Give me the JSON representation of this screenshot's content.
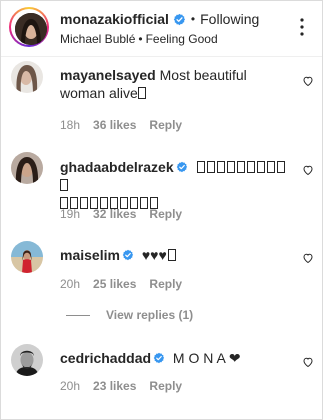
{
  "header": {
    "username": "monazakiofficial",
    "separator": "•",
    "follow_status": "Following",
    "music_artist": "Michael Bublé",
    "music_separator": "•",
    "music_title": "Feeling Good"
  },
  "comments": [
    {
      "username": "mayanelsayed",
      "verified": false,
      "text_line1": "Most beautiful",
      "text_line2": "woman alive",
      "age": "18h",
      "likes": "36 likes",
      "reply": "Reply"
    },
    {
      "username": "ghadaabdelrazek",
      "verified": true,
      "text_line1": "",
      "text_line2": "",
      "age": "19h",
      "likes": "32 likes",
      "reply": "Reply"
    },
    {
      "username": "maiselim",
      "verified": true,
      "text_line1": "♥♥♥",
      "age": "20h",
      "likes": "25 likes",
      "reply": "Reply"
    },
    {
      "username": "cedrichaddad",
      "verified": true,
      "text_line1": "M O N A ❤",
      "age": "20h",
      "likes": "23 likes",
      "reply": "Reply"
    }
  ],
  "view_replies": "View replies (1)",
  "colors": {
    "text": "#262626",
    "muted": "#8e8e8e",
    "verified_blue": "#3897f0",
    "border": "#dbdbdb"
  },
  "icons": [
    "verified-badge-icon",
    "more-options-icon",
    "heart-icon"
  ]
}
